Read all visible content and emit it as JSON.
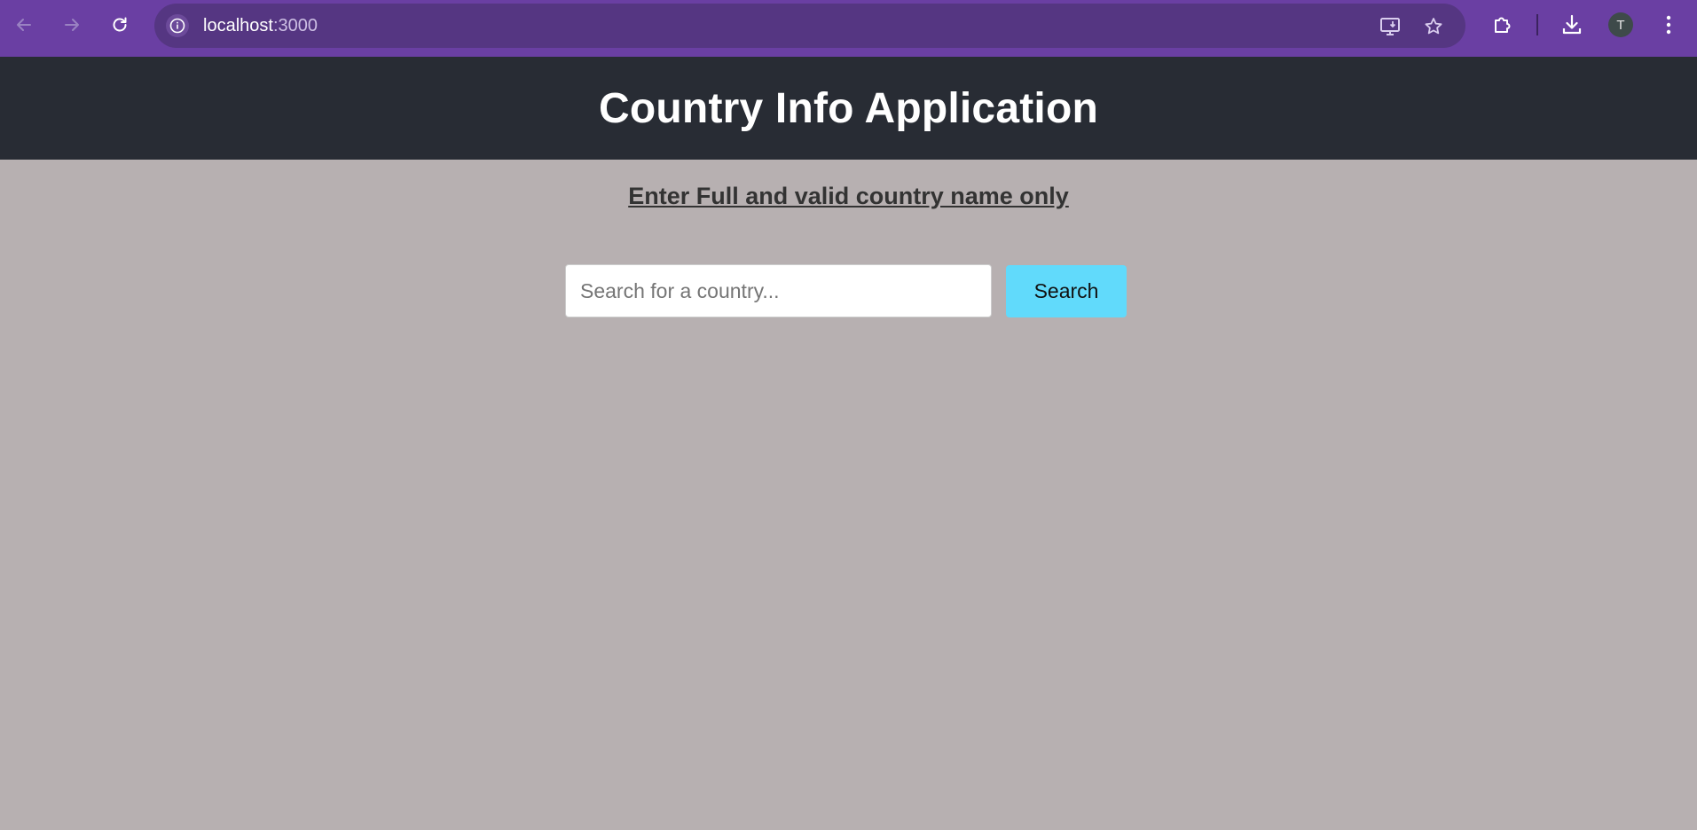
{
  "browser": {
    "url_host": "localhost",
    "url_port": ":3000",
    "profile_initial": "T",
    "icons": [
      "back-arrow-icon",
      "forward-arrow-icon",
      "reload-icon",
      "site-info-icon",
      "install-app-icon",
      "bookmark-star-icon",
      "extensions-puzzle-icon",
      "download-icon",
      "kebab-menu-icon"
    ],
    "colors": {
      "frame": "#6a3fa3",
      "omnibox": "#553682"
    }
  },
  "app": {
    "title": "Country Info Application",
    "instruction": "Enter Full and valid country name only",
    "search": {
      "placeholder": "Search for a country...",
      "value": "",
      "button_label": "Search"
    },
    "colors": {
      "header_bg": "#282c34",
      "page_bg": "#b7b0b1",
      "button_bg": "#61dafb"
    }
  }
}
